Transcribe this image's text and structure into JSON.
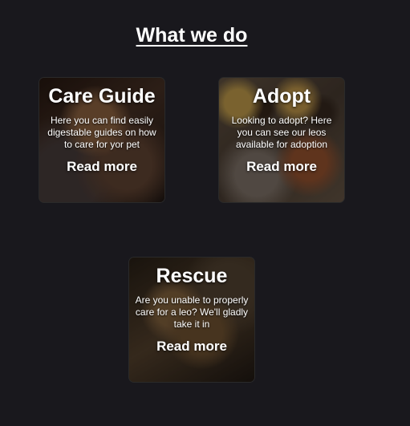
{
  "section": {
    "title": "What we do"
  },
  "cards": [
    {
      "title": "Care Guide",
      "description": "Here you can find easily digestable guides on how to care for yor pet",
      "link": "Read more"
    },
    {
      "title": "Adopt",
      "description": "Looking to adopt? Here you can see our leos available for adoption",
      "link": "Read more"
    },
    {
      "title": "Rescue",
      "description": "Are you unable to properly care for a leo? We'll gladly take it in",
      "link": "Read more"
    }
  ],
  "colors": {
    "background": "#19181d",
    "text": "#ffffff"
  }
}
